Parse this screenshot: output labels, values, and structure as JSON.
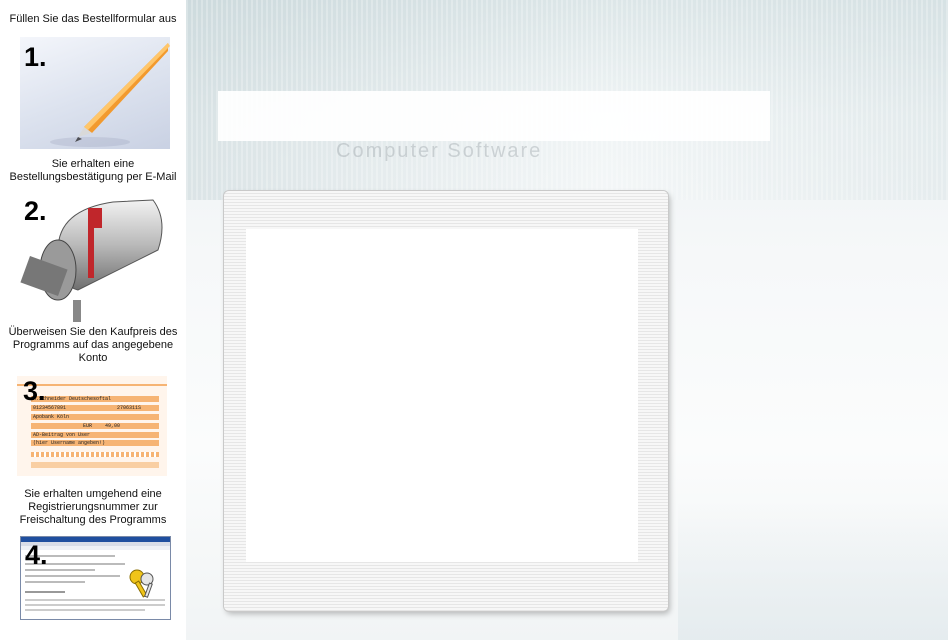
{
  "steps": [
    {
      "number": "1.",
      "caption": "Füllen Sie das Bestellformular  aus",
      "image_icon": "pen-icon"
    },
    {
      "number": "2.",
      "caption": "Sie erhalten eine Bestellungsbestätigung per E-Mail",
      "image_icon": "mailbox-icon"
    },
    {
      "number": "3.",
      "caption": "Überweisen Sie den Kaufpreis des Programms auf das angegebene Konto",
      "image_icon": "transfer-form-icon",
      "form_lines": [
        "n.Schneider Deutschesoftal",
        "01234567891",
        "2706311S",
        "Apobank Köln",
        "EUR",
        "49,00",
        "AD-Beitrag von User",
        "(hier Username angeben!)"
      ]
    },
    {
      "number": "4.",
      "caption": "Sie erhalten umgehend eine Registrierungsnummer zur Freischaltung des Programms",
      "image_icon": "registration-window-icon"
    }
  ],
  "header": {
    "ghost_text": "Computer Software"
  },
  "colors": {
    "orange": "#f29a2e",
    "mailbox_flag": "#c0262b",
    "form_orange": "#f6b474",
    "window_blue": "#1f4f9f"
  }
}
